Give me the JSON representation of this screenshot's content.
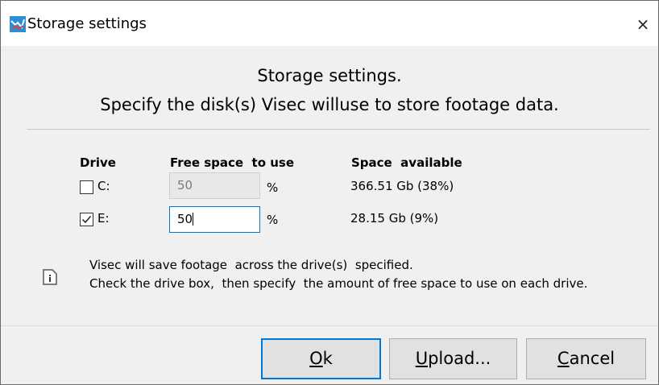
{
  "window": {
    "title": "Storage settings",
    "close_glyph": "×",
    "app_icon": "visec-app-icon"
  },
  "header": {
    "line1": "Storage settings.",
    "line2": "Specify the disk(s) Visec willuse to store footage data."
  },
  "table": {
    "columns": [
      "Drive",
      "Free space  to use",
      "Space  available"
    ],
    "rows": [
      {
        "drive": "C:",
        "checked": false,
        "value": "50",
        "enabled": false,
        "unit": "%",
        "available": "366.51 Gb (38%)"
      },
      {
        "drive": "E:",
        "checked": true,
        "value": "50",
        "enabled": true,
        "unit": "%",
        "available": "28.15 Gb (9%)"
      }
    ]
  },
  "info": {
    "icon": "info-icon",
    "line1": "Visec will save footage  across the drive(s)  specified.",
    "line2": "Check the drive box,  then specify  the amount of free space to use on each drive."
  },
  "buttons": {
    "ok": {
      "mnemonic": "O",
      "rest": "k"
    },
    "upload": {
      "mnemonic": "U",
      "rest": "pload..."
    },
    "cancel": {
      "mnemonic": "C",
      "rest": "ancel"
    }
  },
  "colors": {
    "accent": "#0078d7",
    "dialog_bg": "#f0f0f0"
  }
}
